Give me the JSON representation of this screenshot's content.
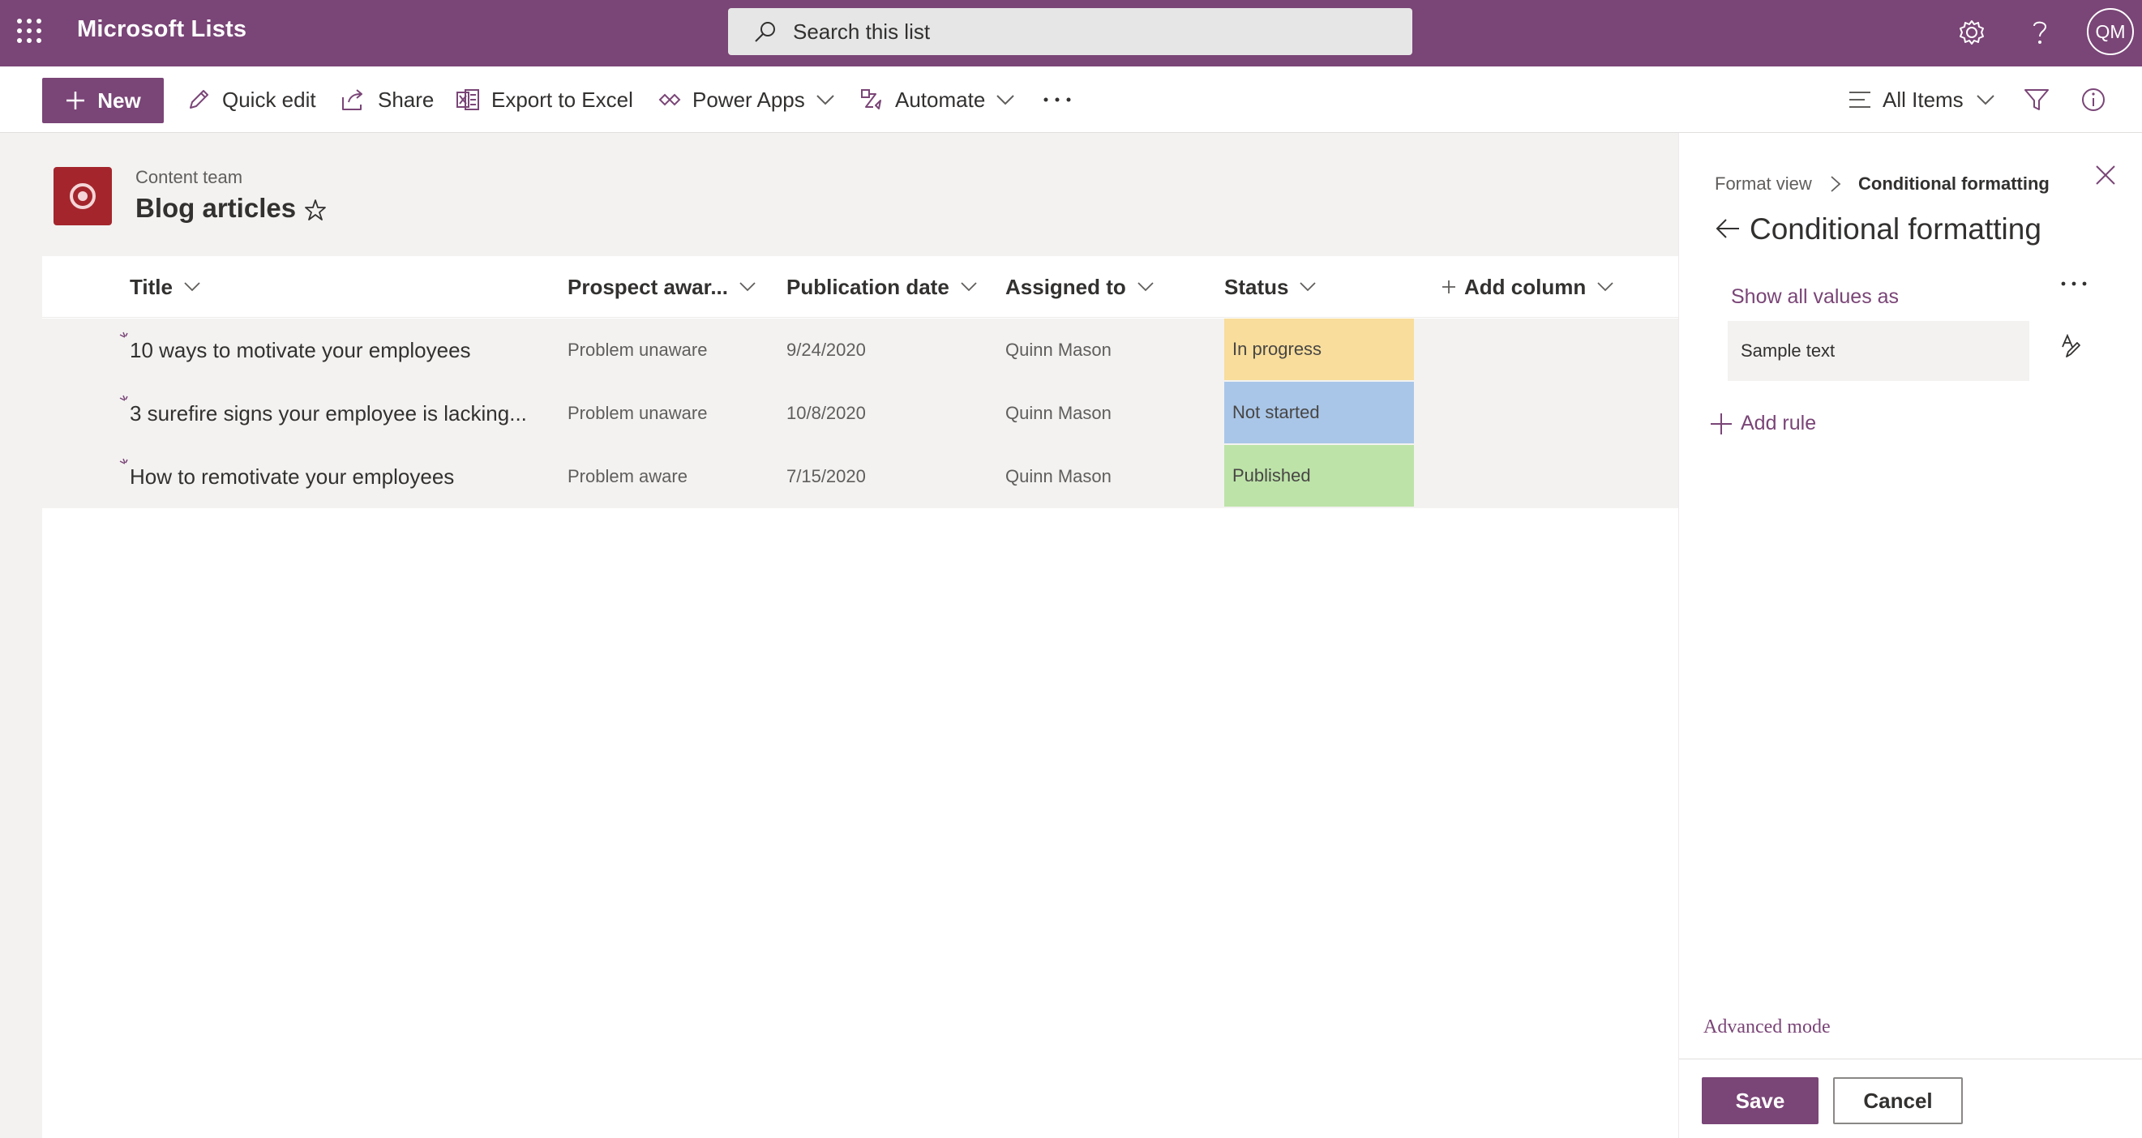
{
  "suite": {
    "app_name": "Microsoft Lists",
    "search_placeholder": "Search this list",
    "user_initials": "QM",
    "icons": [
      "waffle-icon",
      "search-icon",
      "gear-icon",
      "help-icon"
    ]
  },
  "command_bar": {
    "new_label": "New",
    "quick_edit_label": "Quick edit",
    "share_label": "Share",
    "export_label": "Export to Excel",
    "power_apps_label": "Power Apps",
    "automate_label": "Automate",
    "view_label": "All Items"
  },
  "list": {
    "site_name": "Content team",
    "title": "Blog articles",
    "columns": [
      "Title",
      "Prospect awar...",
      "Publication date",
      "Assigned to",
      "Status",
      "Add column"
    ],
    "rows": [
      {
        "title": "10 ways to motivate your employees",
        "prospect": "Problem unaware",
        "date": "9/24/2020",
        "assigned": "Quinn Mason",
        "status": "In progress",
        "status_color": "#f8dd9c"
      },
      {
        "title": "3 surefire signs your employee is lacking...",
        "prospect": "Problem unaware",
        "date": "10/8/2020",
        "assigned": "Quinn Mason",
        "status": "Not started",
        "status_color": "#a9c6e8"
      },
      {
        "title": "How to remotivate your employees",
        "prospect": "Problem aware",
        "date": "7/15/2020",
        "assigned": "Quinn Mason",
        "status": "Published",
        "status_color": "#bde3a9"
      }
    ]
  },
  "panel": {
    "breadcrumb_parent": "Format view",
    "breadcrumb_current": "Conditional formatting",
    "title": "Conditional formatting",
    "show_all_label": "Show all values as",
    "sample_text": "Sample text",
    "add_rule_label": "Add rule",
    "advanced_mode_label": "Advanced mode",
    "save_label": "Save",
    "cancel_label": "Cancel"
  },
  "colors": {
    "brand": "#7a4577",
    "list_icon": "#a4262c"
  }
}
